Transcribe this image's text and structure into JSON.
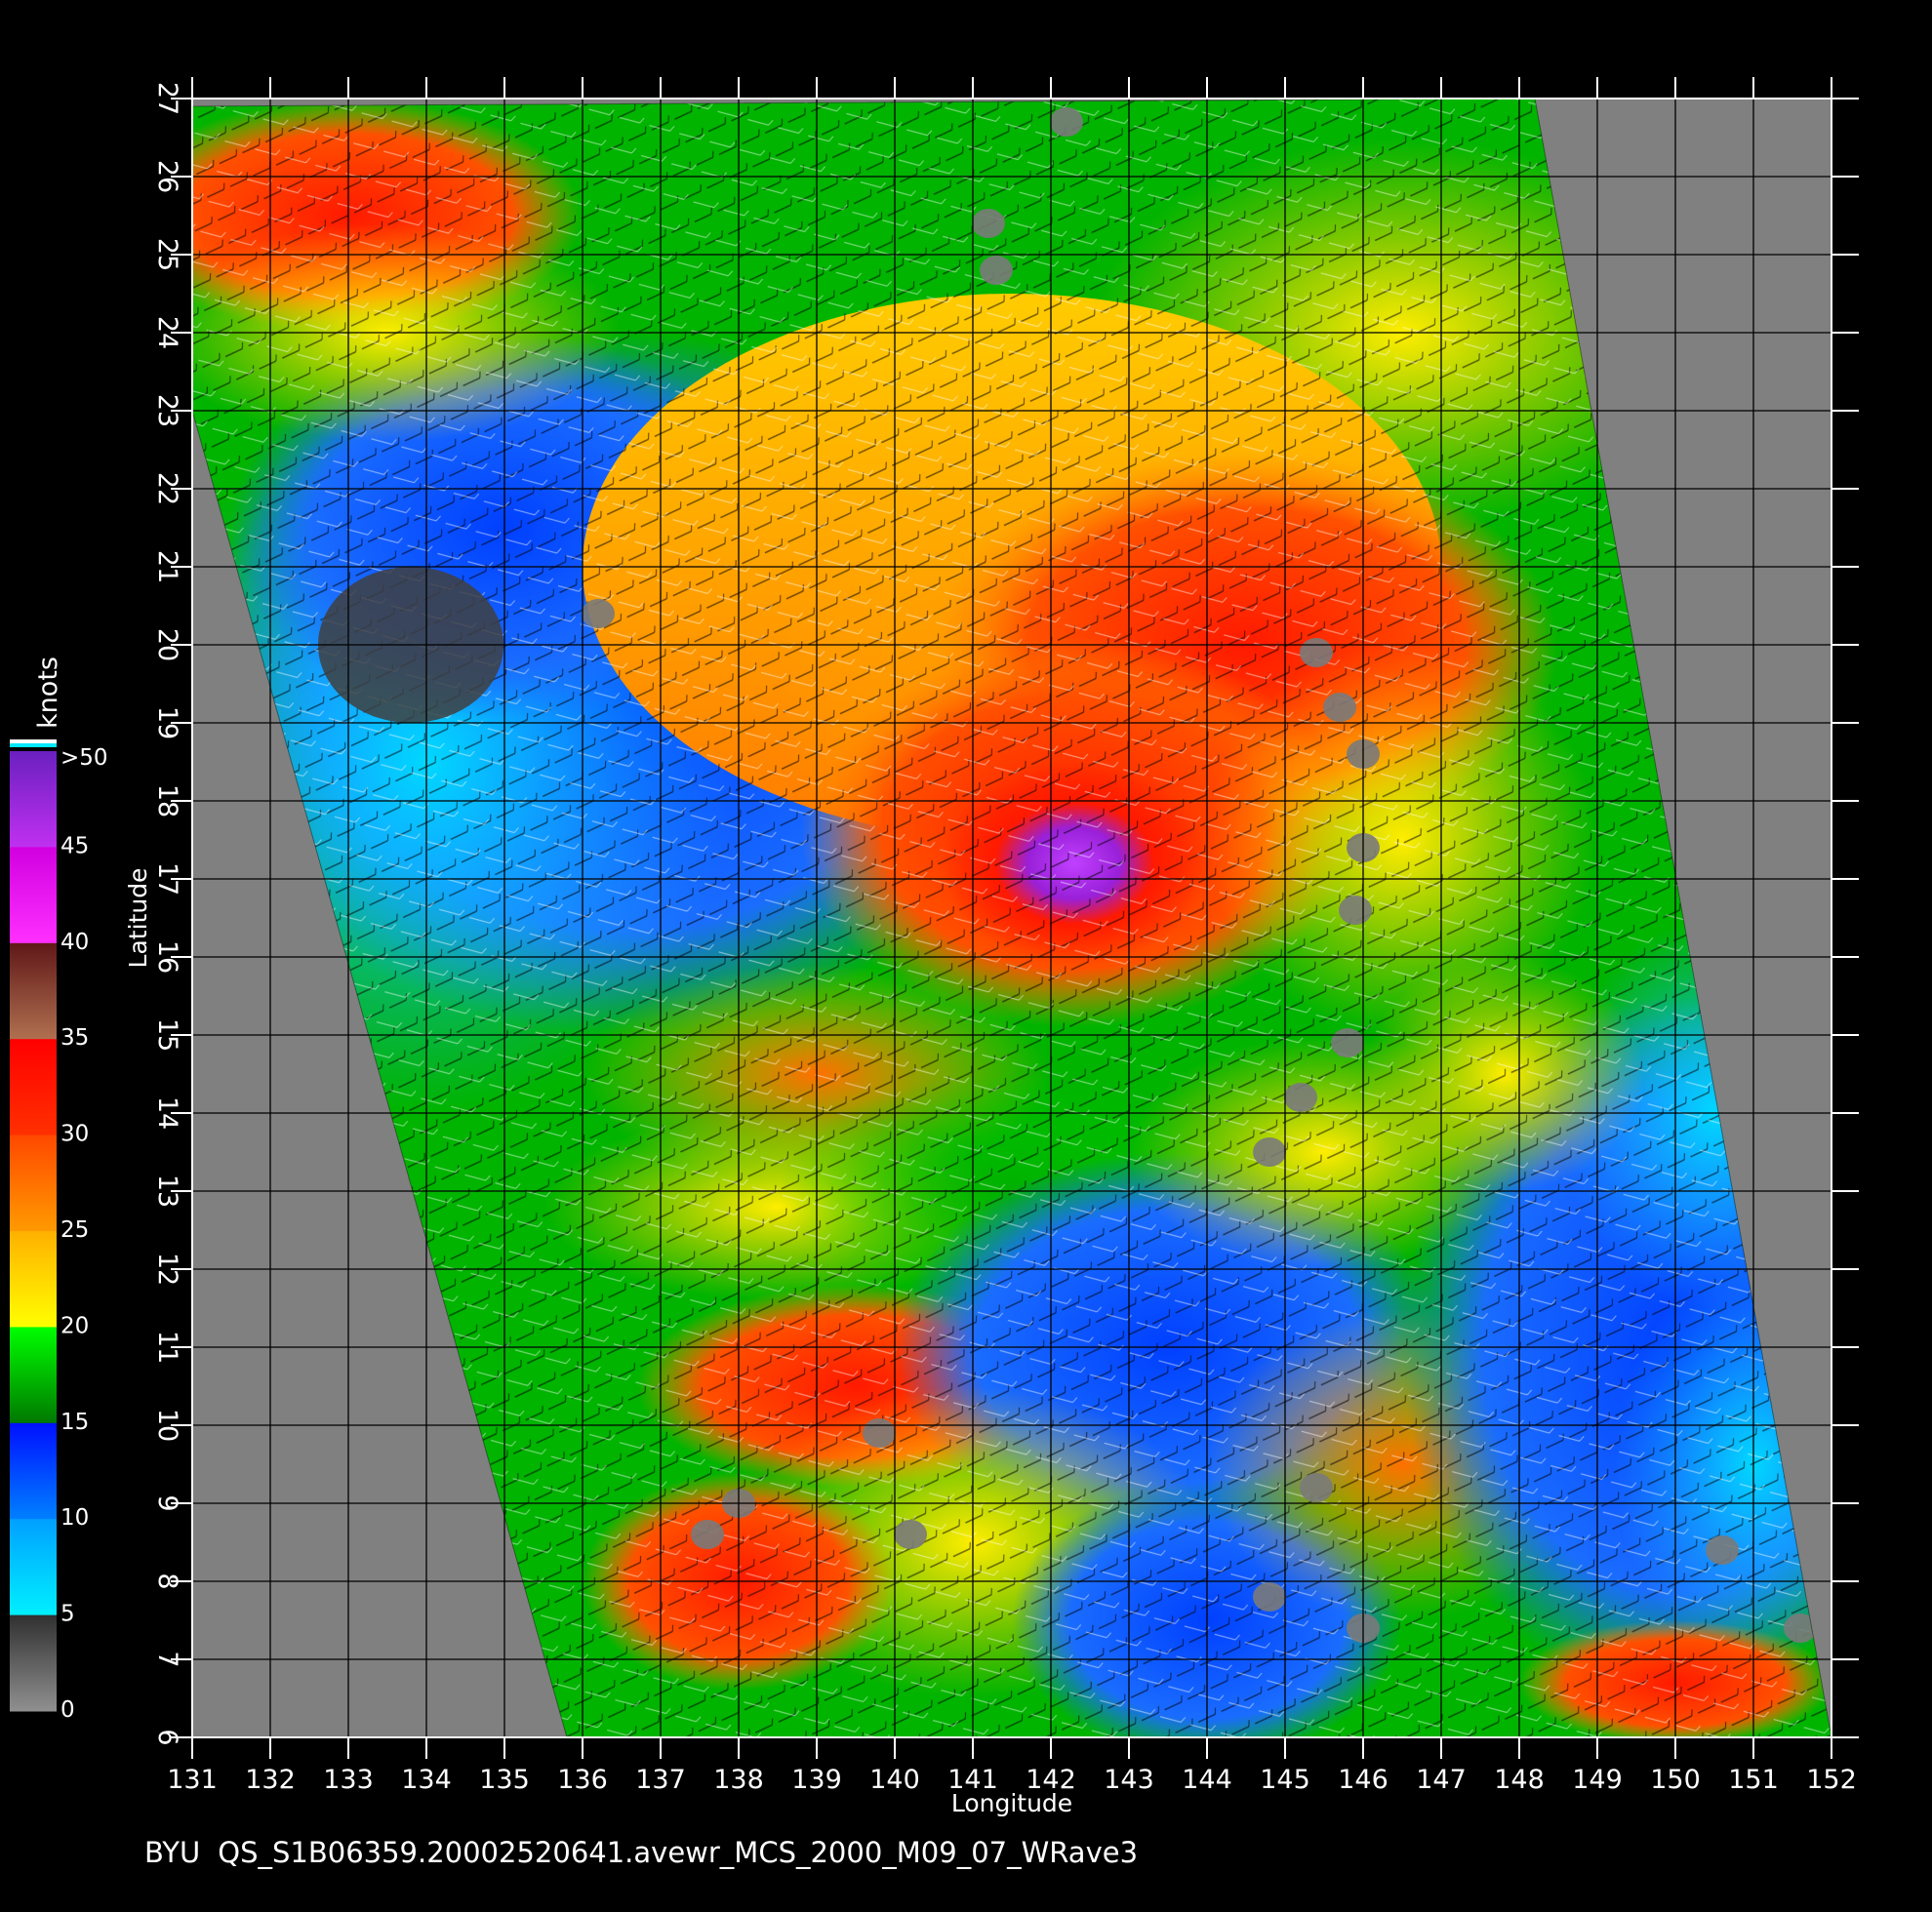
{
  "map": {
    "x_axis": {
      "label": "Longitude",
      "ticks": [
        "131",
        "132",
        "133",
        "134",
        "135",
        "136",
        "137",
        "138",
        "139",
        "140",
        "141",
        "142",
        "143",
        "144",
        "145",
        "146",
        "147",
        "148",
        "149",
        "150",
        "151",
        "152"
      ],
      "range": [
        131,
        152
      ]
    },
    "y_axis": {
      "label": "Latitude",
      "ticks": [
        "6",
        "7",
        "8",
        "9",
        "10",
        "11",
        "12",
        "13",
        "14",
        "15",
        "16",
        "17",
        "18",
        "19",
        "20",
        "21",
        "22",
        "23",
        "24",
        "25",
        "26",
        "27"
      ],
      "range": [
        6,
        27
      ]
    },
    "swath": {
      "corners_lonlat": [
        [
          131.0,
          23.0
        ],
        [
          148.2,
          27.0
        ],
        [
          152.0,
          6.0
        ],
        [
          135.8,
          6.0
        ]
      ],
      "upper_left_edge": [
        [
          131.0,
          26.9
        ],
        [
          131.0,
          23.0
        ]
      ]
    },
    "storm_center_lonlat": [
      142.3,
      17.2
    ],
    "footer": {
      "institution": "BYU",
      "product": "QS_S1B06359.20002520641.avewr_MCS_2000_M09_07_WRave3"
    }
  },
  "colorbar": {
    "title": "knots",
    "ticks": [
      ">50",
      "45",
      "40",
      "35",
      "30",
      "25",
      "20",
      "15",
      "10",
      "5",
      "0"
    ],
    "colors": {
      "0_5": [
        "#8a8a8a",
        "#444444"
      ],
      "5_10": [
        "#00e8ff",
        "#00a8ff"
      ],
      "10_15": [
        "#0070ff",
        "#0018ff"
      ],
      "15_20": [
        "#008800",
        "#00ff00"
      ],
      "20_25": [
        "#ffff00",
        "#ffc000"
      ],
      "25_30": [
        "#ff9a00",
        "#ff5a00"
      ],
      "30_35": [
        "#ff3000",
        "#ff0000"
      ],
      "35_40": [
        "#702020",
        "#a06048"
      ],
      "40_45": [
        "#ff30ff",
        "#e000e8"
      ],
      "45_50": [
        "#b030e0",
        "#6820c0"
      ]
    },
    "missing_color": "#808080"
  }
}
